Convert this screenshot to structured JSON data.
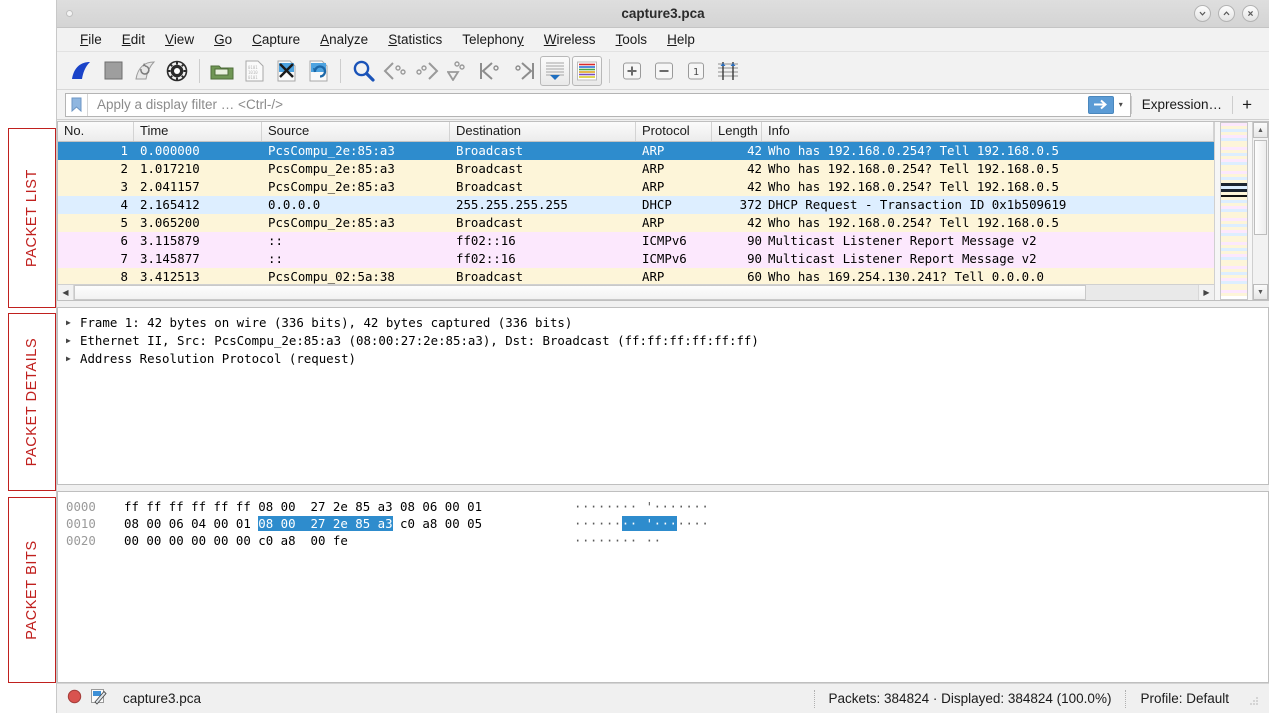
{
  "window": {
    "title": "capture3.pca",
    "controls": [
      {
        "name": "minimize-button",
        "glyph": "∨"
      },
      {
        "name": "maximize-button",
        "glyph": "∧"
      },
      {
        "name": "close-button",
        "glyph": "✕"
      }
    ]
  },
  "menubar": {
    "items": [
      {
        "label": "File",
        "mnemonic": "F"
      },
      {
        "label": "Edit",
        "mnemonic": "E"
      },
      {
        "label": "View",
        "mnemonic": "V"
      },
      {
        "label": "Go",
        "mnemonic": "G"
      },
      {
        "label": "Capture",
        "mnemonic": "C"
      },
      {
        "label": "Analyze",
        "mnemonic": "A"
      },
      {
        "label": "Statistics",
        "mnemonic": "S"
      },
      {
        "label": "Telephony",
        "mnemonic": "y"
      },
      {
        "label": "Wireless",
        "mnemonic": "W"
      },
      {
        "label": "Tools",
        "mnemonic": "T"
      },
      {
        "label": "Help",
        "mnemonic": "H"
      }
    ]
  },
  "toolbar": {
    "items": [
      {
        "name": "start-capture-icon",
        "title": "Start capturing packets"
      },
      {
        "name": "stop-capture-icon",
        "title": "Stop capturing packets"
      },
      {
        "name": "restart-capture-icon",
        "title": "Restart current capture"
      },
      {
        "name": "capture-options-icon",
        "title": "Capture options"
      },
      {
        "name": "open-file-icon",
        "title": "Open a capture file"
      },
      {
        "name": "save-file-icon",
        "title": "Save this capture file"
      },
      {
        "name": "close-file-icon",
        "title": "Close this capture file"
      },
      {
        "name": "reload-file-icon",
        "title": "Reload this file"
      },
      {
        "name": "find-packet-icon",
        "title": "Find a packet"
      },
      {
        "name": "go-back-icon",
        "title": "Go back in packet history"
      },
      {
        "name": "go-forward-icon",
        "title": "Go forward in packet history"
      },
      {
        "name": "go-to-packet-icon",
        "title": "Go to the packet"
      },
      {
        "name": "go-first-packet-icon",
        "title": "Go to the first packet"
      },
      {
        "name": "go-last-packet-icon",
        "title": "Go to the last packet"
      },
      {
        "name": "auto-scroll-icon",
        "title": "Auto scroll in live capture"
      },
      {
        "name": "colorize-icon",
        "title": "Colorize packet list"
      },
      {
        "name": "zoom-in-icon",
        "title": "Zoom in"
      },
      {
        "name": "zoom-out-icon",
        "title": "Zoom out"
      },
      {
        "name": "zoom-reset-icon",
        "title": "Normal size",
        "label": "1"
      },
      {
        "name": "resize-columns-icon",
        "title": "Resize columns"
      }
    ]
  },
  "filterbar": {
    "placeholder": "Apply a display filter … <Ctrl-/>",
    "value": "",
    "apply_label": "➡",
    "dropdown_label": "▾",
    "expression_label": "Expression…",
    "add_label": "+"
  },
  "packet_list": {
    "columns": [
      "No.",
      "Time",
      "Source",
      "Destination",
      "Protocol",
      "Length",
      "Info"
    ],
    "rows": [
      {
        "no": "1",
        "time": "0.000000",
        "source": "PcsCompu_2e:85:a3",
        "destination": "Broadcast",
        "protocol": "ARP",
        "length": "42",
        "info": "Who has 192.168.0.254? Tell 192.168.0.5",
        "bg": "#2e8ccd",
        "selected": true
      },
      {
        "no": "2",
        "time": "1.017210",
        "source": "PcsCompu_2e:85:a3",
        "destination": "Broadcast",
        "protocol": "ARP",
        "length": "42",
        "info": "Who has 192.168.0.254? Tell 192.168.0.5",
        "bg": "#fdf5d9",
        "selected": false
      },
      {
        "no": "3",
        "time": "2.041157",
        "source": "PcsCompu_2e:85:a3",
        "destination": "Broadcast",
        "protocol": "ARP",
        "length": "42",
        "info": "Who has 192.168.0.254? Tell 192.168.0.5",
        "bg": "#fdf5d9",
        "selected": false
      },
      {
        "no": "4",
        "time": "2.165412",
        "source": "0.0.0.0",
        "destination": "255.255.255.255",
        "protocol": "DHCP",
        "length": "372",
        "info": "DHCP Request  - Transaction ID 0x1b509619",
        "bg": "#ddeeff",
        "selected": false
      },
      {
        "no": "5",
        "time": "3.065200",
        "source": "PcsCompu_2e:85:a3",
        "destination": "Broadcast",
        "protocol": "ARP",
        "length": "42",
        "info": "Who has 192.168.0.254? Tell 192.168.0.5",
        "bg": "#fdf5d9",
        "selected": false
      },
      {
        "no": "6",
        "time": "3.115879",
        "source": "::",
        "destination": "ff02::16",
        "protocol": "ICMPv6",
        "length": "90",
        "info": "Multicast Listener Report Message v2",
        "bg": "#fce8fd",
        "selected": false
      },
      {
        "no": "7",
        "time": "3.145877",
        "source": "::",
        "destination": "ff02::16",
        "protocol": "ICMPv6",
        "length": "90",
        "info": "Multicast Listener Report Message v2",
        "bg": "#fce8fd",
        "selected": false
      },
      {
        "no": "8",
        "time": "3.412513",
        "source": "PcsCompu_02:5a:38",
        "destination": "Broadcast",
        "protocol": "ARP",
        "length": "60",
        "info": "Who has 169.254.130.241? Tell 0.0.0.0",
        "bg": "#fdf5d9",
        "selected": false
      }
    ]
  },
  "packet_details": {
    "rows": [
      {
        "text": "Frame 1: 42 bytes on wire (336 bits), 42 bytes captured (336 bits)",
        "expanded": false
      },
      {
        "text": "Ethernet II, Src: PcsCompu_2e:85:a3 (08:00:27:2e:85:a3), Dst: Broadcast (ff:ff:ff:ff:ff:ff)",
        "expanded": false
      },
      {
        "text": "Address Resolution Protocol (request)",
        "expanded": false
      }
    ]
  },
  "packet_bytes": {
    "rows": [
      {
        "offset": "0000",
        "pre": "ff ff ff ff ff ff 08 00  27 2e 85 a3 08 06 00 01",
        "sel": "",
        "post": "",
        "ascii_pre": "········ '·······",
        "ascii_sel": "",
        "ascii_post": ""
      },
      {
        "offset": "0010",
        "pre": "08 00 06 04 00 01 ",
        "sel": "08 00  27 2e 85 a3",
        "post": " c0 a8 00 05",
        "ascii_pre": "······",
        "ascii_sel": "·· '···",
        "ascii_post": "····"
      },
      {
        "offset": "0020",
        "pre": "00 00 00 00 00 00 c0 a8  00 fe",
        "sel": "",
        "post": "",
        "ascii_pre": "········ ··",
        "ascii_sel": "",
        "ascii_post": ""
      }
    ]
  },
  "statusbar": {
    "capture_icon": "record-icon",
    "expert_icon": "capture-comment-icon",
    "file": "capture3.pca",
    "stats": "Packets: 384824 · Displayed: 384824 (100.0%)",
    "profile": "Profile: Default"
  },
  "annotations": [
    {
      "label": "PACKET LIST"
    },
    {
      "label": "PACKET DETAILS"
    },
    {
      "label": "PACKET BITS"
    }
  ],
  "colors": {
    "selection": "#2e8ccd",
    "annotation": "#c0201e",
    "arp_row": "#fdf5d9",
    "dhcp_row": "#ddeeff",
    "icmpv6_row": "#fce8fd"
  }
}
